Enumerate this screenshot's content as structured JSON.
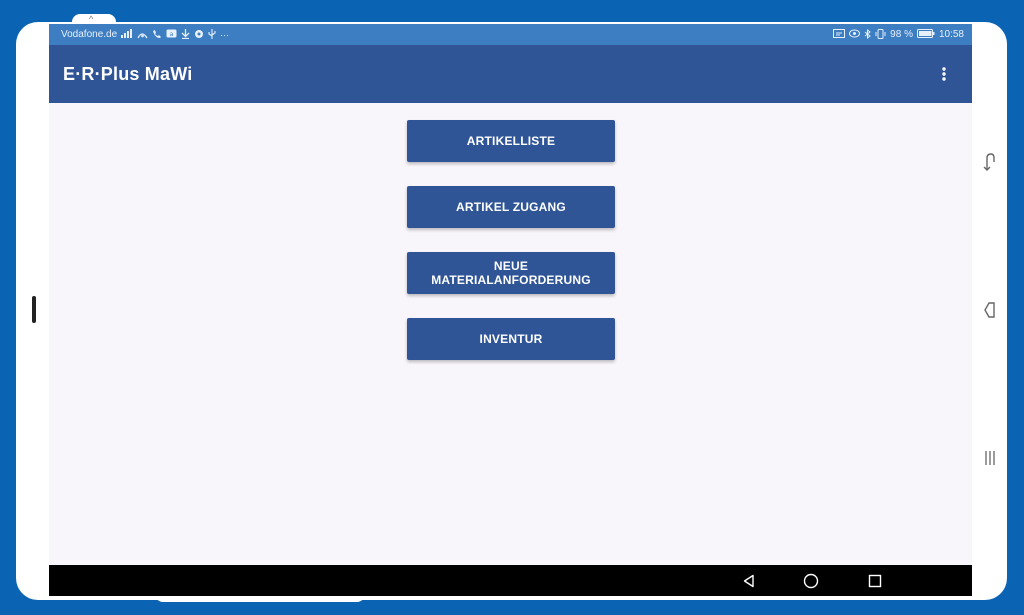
{
  "statusbar": {
    "carrier": "Vodafone.de",
    "battery": "98 %",
    "time": "10:58",
    "left_icons": [
      "signal-icon",
      "nfc-icon",
      "call-icon",
      "message-icon",
      "download-icon",
      "location-icon",
      "usb-icon",
      "more-icon"
    ],
    "right_icons": [
      "cast-icon",
      "eye-icon",
      "bluetooth-icon",
      "vibrate-icon",
      "battery-icon"
    ]
  },
  "appbar": {
    "title": "E·R·Plus MaWi",
    "overflow_icon": "more-vert-icon"
  },
  "menu": {
    "buttons": [
      {
        "label": "ARTIKELLISTE"
      },
      {
        "label": "ARTIKEL ZUGANG"
      },
      {
        "label": "NEUE MATERIALANFORDERUNG"
      },
      {
        "label": "INVENTUR"
      }
    ]
  },
  "navbar": {
    "icons": [
      "back-icon",
      "home-icon",
      "recents-icon"
    ]
  },
  "colors": {
    "primary": "#2f5597",
    "statusbar": "#3d7ec2",
    "background": "#f9f6fb",
    "desktop": "#0a63b3"
  }
}
